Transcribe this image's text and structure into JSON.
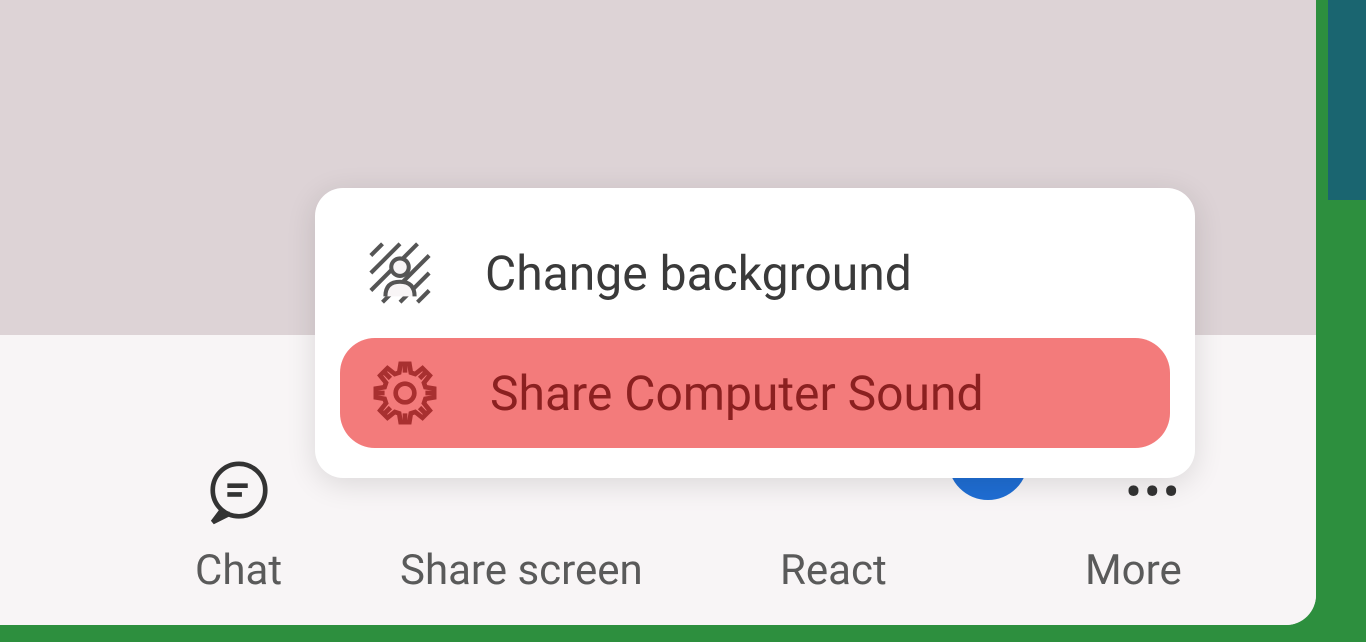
{
  "toolbar": {
    "chat_label": "Chat",
    "share_label": "Share screen",
    "react_label": "React",
    "more_label": "More"
  },
  "popup": {
    "change_background_label": "Change background",
    "share_sound_label": "Share Computer Sound"
  },
  "icons": {
    "chat": "chat-bubble-icon",
    "more": "more-dots-icon",
    "pencil": "pencil-icon",
    "background_effect": "background-effect-icon",
    "gear": "gear-icon"
  },
  "colors": {
    "highlight": "#f37b7b",
    "highlight_text": "#8b2020",
    "accent_blue": "#1f6ed4",
    "frame_green": "#2d8f3e"
  }
}
